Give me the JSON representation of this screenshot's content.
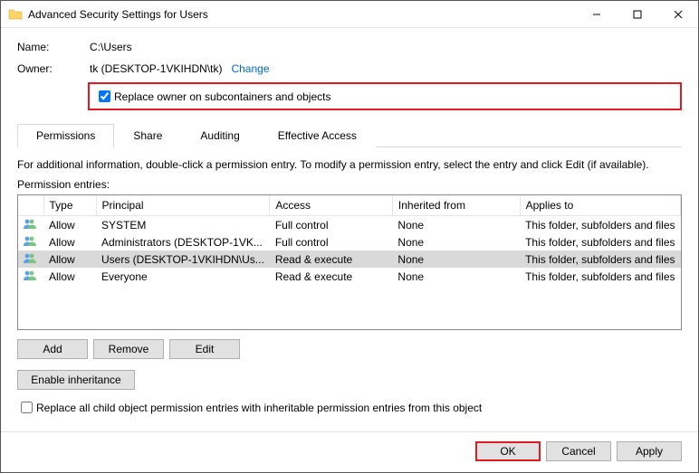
{
  "window": {
    "title": "Advanced Security Settings for Users"
  },
  "labels": {
    "name": "Name:",
    "owner": "Owner:",
    "info": "For additional information, double-click a permission entry. To modify a permission entry, select the entry and click Edit (if available).",
    "entries": "Permission entries:"
  },
  "values": {
    "name": "C:\\Users",
    "owner": "tk (DESKTOP-1VKIHDN\\tk)",
    "change": "Change",
    "replace_owner": "Replace owner on subcontainers and objects",
    "replace_child": "Replace all child object permission entries with inheritable permission entries from this object"
  },
  "tabs": {
    "permissions": "Permissions",
    "share": "Share",
    "auditing": "Auditing",
    "effective": "Effective Access"
  },
  "columns": {
    "type": "Type",
    "principal": "Principal",
    "access": "Access",
    "inherited": "Inherited from",
    "applies": "Applies to"
  },
  "rows": [
    {
      "type": "Allow",
      "principal": "SYSTEM",
      "access": "Full control",
      "inherited": "None",
      "applies": "This folder, subfolders and files"
    },
    {
      "type": "Allow",
      "principal": "Administrators (DESKTOP-1VK...",
      "access": "Full control",
      "inherited": "None",
      "applies": "This folder, subfolders and files"
    },
    {
      "type": "Allow",
      "principal": "Users (DESKTOP-1VKIHDN\\Us...",
      "access": "Read & execute",
      "inherited": "None",
      "applies": "This folder, subfolders and files"
    },
    {
      "type": "Allow",
      "principal": "Everyone",
      "access": "Read & execute",
      "inherited": "None",
      "applies": "This folder, subfolders and files"
    }
  ],
  "buttons": {
    "add": "Add",
    "remove": "Remove",
    "edit": "Edit",
    "enable_inherit": "Enable inheritance",
    "ok": "OK",
    "cancel": "Cancel",
    "apply": "Apply"
  }
}
